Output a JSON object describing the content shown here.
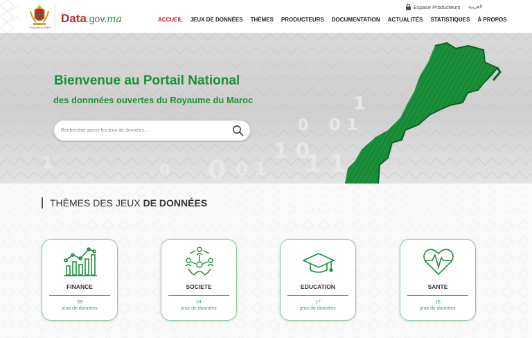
{
  "header": {
    "emblem_label": "Royaume du Maroc",
    "logo": {
      "data": "Data",
      "gov": ".gov.",
      "ma": "ma"
    },
    "espace_producteurs": "Espace Producteurs",
    "arabic_link": "العربية",
    "nav": [
      "ACCUEIL",
      "JEUX DE DONNÉES",
      "THÈMES",
      "PRODUCTEURS",
      "DOCUMENTATION",
      "ACTUALITÉS",
      "STATISTIQUES",
      "À PROPOS"
    ],
    "active_nav": "ACCUEIL"
  },
  "hero": {
    "title": "Bienvenue au Portail National",
    "subtitle": "des donnnées ouvertes du Royaume du Maroc",
    "search_placeholder": "Rechercher parmi les jeux de données..."
  },
  "themes": {
    "title_light": "THÈMES DES JEUX",
    "title_bold": "DE DONNÉES",
    "cards": [
      {
        "name": "FINANCE",
        "count": "59",
        "label": "jeux de données",
        "icon": "chart-icon"
      },
      {
        "name": "SOCIETE",
        "count": "24",
        "label": "jeux de données",
        "icon": "people-network-icon"
      },
      {
        "name": "EDUCATION",
        "count": "17",
        "label": "jeux de données",
        "icon": "graduation-cap-icon"
      },
      {
        "name": "SANTE",
        "count": "16",
        "label": "jeux de données",
        "icon": "heart-pulse-icon"
      }
    ]
  },
  "colors": {
    "brand_green": "#1b8f3a",
    "brand_red": "#c0272d"
  }
}
